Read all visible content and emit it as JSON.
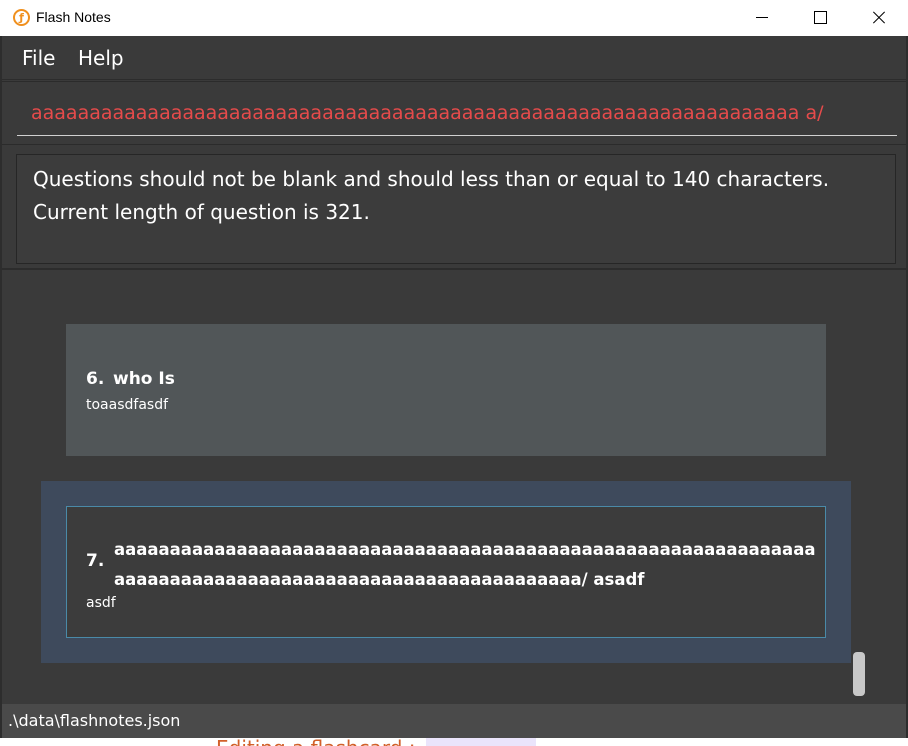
{
  "window": {
    "title": "Flash Notes",
    "icon": "flash-notes-logo"
  },
  "menu": {
    "file": "File",
    "help": "Help"
  },
  "command": {
    "value": "aaaaaaaaaaaaaaaaaaaaaaaaaaaaaaaaaaaaaaaaaaaaaaaaaaaaaaaaaaaaaaaaaa a/"
  },
  "result": {
    "message": "Questions should not be blank and should less than or equal to 140 characters. Current length of question is 321."
  },
  "cards": [
    {
      "index": "6.",
      "question": "who Is",
      "answer": "toaasdfasdf"
    },
    {
      "index": "7.",
      "question": "aaaaaaaaaaaaaaaaaaaaaaaaaaaaaaaaaaaaaaaaaaaaaaaaaaaaaaaaaaaaaaaaaaaaaaaaaaaaaaaaaaaaaaaaaaaaaaaaaaaaaaaaa/ asadf",
      "answer": "asdf"
    }
  ],
  "status": {
    "path": ".\\data\\flashnotes.json"
  },
  "background": {
    "partial_text": "Editing a flashcard :"
  },
  "colors": {
    "error_text": "#e64b4b",
    "selected_card": "#3e4a5c",
    "card_bg": "#515658",
    "accent_border": "#4a8aa8"
  }
}
